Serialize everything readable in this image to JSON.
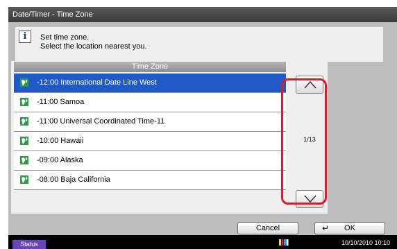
{
  "window": {
    "title": "Date/Timer - Time Zone"
  },
  "info": {
    "line1": "Set time zone.",
    "line2": "Select the location nearest you."
  },
  "list": {
    "header": "Time Zone",
    "items": [
      {
        "label": "-12:00 International Date Line West",
        "selected": true
      },
      {
        "label": "-11:00 Samoa",
        "selected": false
      },
      {
        "label": "-11:00 Universal Coordinated Time-11",
        "selected": false
      },
      {
        "label": "-10:00 Hawaii",
        "selected": false
      },
      {
        "label": "-09:00 Alaska",
        "selected": false
      },
      {
        "label": "-08:00 Baja California",
        "selected": false
      }
    ],
    "page_indicator": "1/13"
  },
  "buttons": {
    "cancel": "Cancel",
    "ok": "OK"
  },
  "status_bar": {
    "status": "Status",
    "datetime": "10/10/2010  10:10"
  },
  "colors": {
    "selected_row": "#1f5ac6",
    "highlight": "#e01a2a",
    "status_button": "#6645b8"
  },
  "icons": [
    "info-icon",
    "globe-icon",
    "chevron-up-icon",
    "chevron-down-icon",
    "enter-icon",
    "toner-icon"
  ]
}
